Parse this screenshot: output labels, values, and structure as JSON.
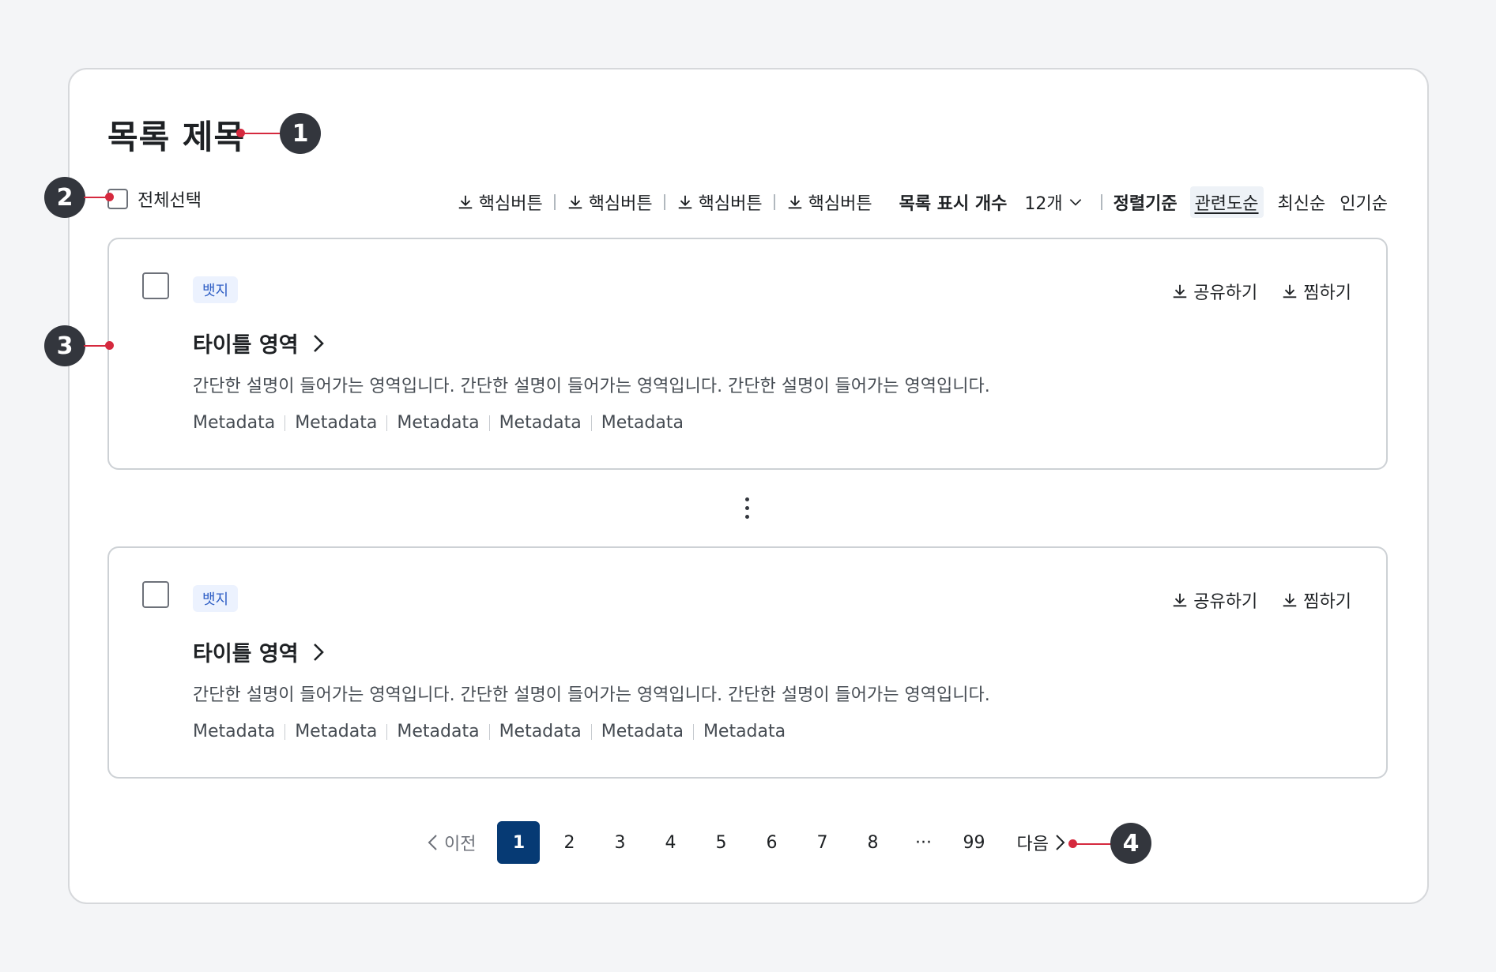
{
  "page": {
    "title": "목록 제목"
  },
  "callouts": [
    "1",
    "2",
    "3",
    "4"
  ],
  "toolbar": {
    "select_all_label": "전체선택",
    "tool_buttons": [
      "핵심버튼",
      "핵심버튼",
      "핵심버튼",
      "핵심버튼"
    ],
    "display_count_label": "목록 표시 개수",
    "display_count_value": "12개",
    "sort_label": "정렬기준",
    "sort_options": [
      "관련도순",
      "최신순",
      "인기순"
    ],
    "sort_selected": "관련도순"
  },
  "cards": [
    {
      "badge": "뱃지",
      "title": "타이틀 영역",
      "description": "간단한 설명이 들어가는 영역입니다. 간단한 설명이 들어가는 영역입니다. 간단한 설명이 들어가는 영역입니다.",
      "actions": [
        "공유하기",
        "찜하기"
      ],
      "metadata": [
        "Metadata",
        "Metadata",
        "Metadata",
        "Metadata",
        "Metadata"
      ]
    },
    {
      "badge": "뱃지",
      "title": "타이틀 영역",
      "description": "간단한 설명이 들어가는 영역입니다. 간단한 설명이 들어가는 영역입니다. 간단한 설명이 들어가는 영역입니다.",
      "actions": [
        "공유하기",
        "찜하기"
      ],
      "metadata": [
        "Metadata",
        "Metadata",
        "Metadata",
        "Metadata",
        "Metadata",
        "Metadata"
      ]
    }
  ],
  "pagination": {
    "prev_label": "이전",
    "next_label": "다음",
    "pages": [
      "1",
      "2",
      "3",
      "4",
      "5",
      "6",
      "7",
      "8"
    ],
    "ellipsis": "···",
    "last_page": "99",
    "current": "1"
  },
  "colors": {
    "accent": "#063a74",
    "callout_bg": "#33363d",
    "leader_line": "#d5293e",
    "badge_bg": "#ecf2fe",
    "badge_text": "#2f5fc5"
  }
}
